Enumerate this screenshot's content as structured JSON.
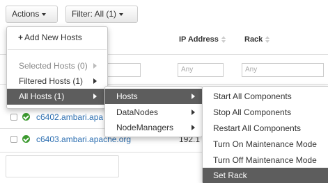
{
  "toolbar": {
    "actions_label": "Actions",
    "filter_label": "Filter:",
    "filter_value": "All (1)"
  },
  "table": {
    "headers": {
      "ip": "IP Address",
      "rack": "Rack"
    },
    "filters": {
      "ip_placeholder": "Any",
      "rack_placeholder": "Any"
    },
    "rows": [
      {
        "name": "c6402.ambari.apa",
        "ip": ""
      },
      {
        "name": "c6403.ambari.apache.org",
        "ip": "192.1"
      }
    ]
  },
  "actions_menu": {
    "add_hosts": "Add New Hosts",
    "selected_hosts": "Selected Hosts (0)",
    "filtered_hosts": "Filtered Hosts (1)",
    "all_hosts": "All Hosts (1)"
  },
  "component_menu": {
    "hosts": "Hosts",
    "datanodes": "DataNodes",
    "nodemanagers": "NodeManagers"
  },
  "hosts_submenu": {
    "items": [
      "Start All Components",
      "Stop All Components",
      "Restart All Components",
      "Turn On Maintenance Mode",
      "Turn Off Maintenance Mode",
      "Set Rack"
    ]
  },
  "colors": {
    "menu_active_bg": "#5d5d5d",
    "link": "#2a6db0",
    "status_ok": "#3c9a2f"
  }
}
